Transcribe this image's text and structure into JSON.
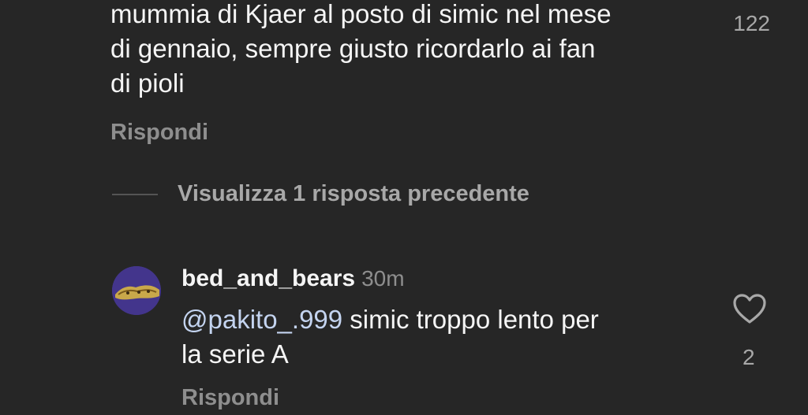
{
  "top_comment": {
    "text_lines": [
      "mummia di Kjaer al posto di simic nel mese",
      "di gennaio, sempre giusto ricordarlo ai fan",
      "di pioli"
    ],
    "like_count": "122",
    "reply_label": "Rispondi"
  },
  "view_replies": {
    "label": "Visualizza 1 risposta precedente"
  },
  "reply": {
    "username": "bed_and_bears",
    "timestamp": "30m",
    "mention": "@pakito_.999",
    "text_line1": " simic troppo lento per",
    "text_line2": "la serie A",
    "like_count": "2",
    "reply_label": "Rispondi",
    "icon": "heart-icon"
  },
  "colors": {
    "background": "#262626",
    "primary_text": "#f5f5f5",
    "secondary_text": "#8e8e8e",
    "mention": "#c4d4f0"
  }
}
